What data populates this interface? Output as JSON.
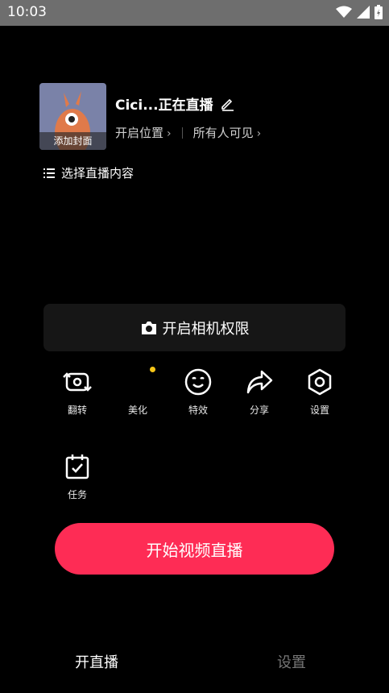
{
  "status_bar": {
    "time": "10:03"
  },
  "live": {
    "cover_label": "添加封面",
    "title": "Cici...正在直播",
    "location_label": "开启位置",
    "visibility_label": "所有人可见",
    "content_select_label": "选择直播内容"
  },
  "camera_permission": {
    "label": "开启相机权限"
  },
  "tools": [
    {
      "label": "翻转",
      "icon": "flip-camera-icon"
    },
    {
      "label": "美化",
      "icon": "beauty-icon"
    },
    {
      "label": "特效",
      "icon": "effects-smiley-icon"
    },
    {
      "label": "分享",
      "icon": "share-arrow-icon"
    },
    {
      "label": "设置",
      "icon": "settings-hexagon-icon"
    },
    {
      "label": "任务",
      "icon": "task-checklist-icon"
    }
  ],
  "start_button": {
    "label": "开始视频直播"
  },
  "bottom_tabs": [
    {
      "label": "开直播",
      "active": true
    },
    {
      "label": "设置",
      "active": false
    }
  ],
  "colors": {
    "accent": "#fe2c55",
    "dot": "#f5c518",
    "background": "#000000"
  }
}
